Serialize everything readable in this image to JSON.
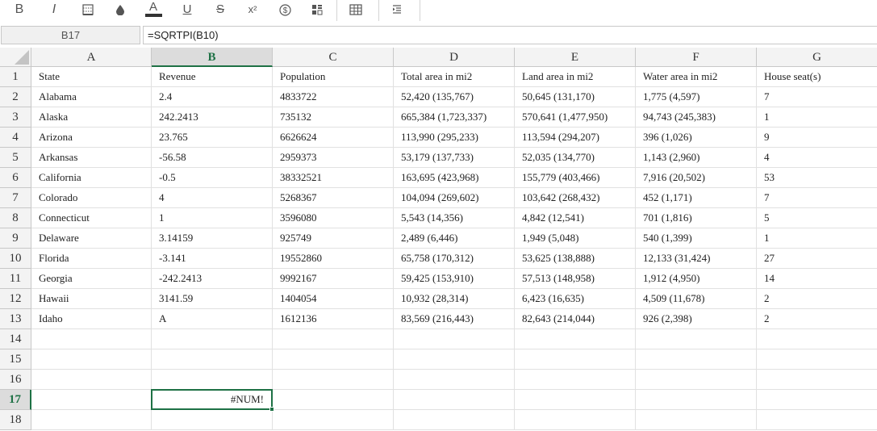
{
  "toolbar": {
    "bold_label": "B",
    "italic_label": "I",
    "font_color_label": "A",
    "underline_label": "U",
    "strike_label": "S",
    "superscript_label": "x²",
    "icons": [
      "borders-icon",
      "fill-color-icon",
      "font-color-icon",
      "underline-icon",
      "strikethrough-icon",
      "superscript-icon",
      "currency-icon",
      "conditional-format-icon",
      "table-icon",
      "indent-icon"
    ],
    "font_color_swatch": "#333333"
  },
  "formula_bar": {
    "cell_ref": "B17",
    "formula": "=SQRTPI(B10)"
  },
  "sheet": {
    "accent": "#1e7145",
    "columns": [
      "A",
      "B",
      "C",
      "D",
      "E",
      "F",
      "G"
    ],
    "active_column": "B",
    "active_row": "17",
    "row_numbers": [
      "1",
      "2",
      "3",
      "4",
      "5",
      "6",
      "7",
      "8",
      "9",
      "10",
      "11",
      "12",
      "13",
      "14",
      "15",
      "16",
      "17",
      "18"
    ],
    "rows": [
      [
        "State",
        "Revenue",
        "Population",
        "Total area in mi2",
        "Land area in mi2",
        "Water area in mi2",
        "House seat(s)"
      ],
      [
        "Alabama",
        "2.4",
        "4833722",
        "52,420 (135,767)",
        "50,645 (131,170)",
        "1,775 (4,597)",
        "7"
      ],
      [
        "Alaska",
        "242.2413",
        "735132",
        "665,384 (1,723,337)",
        "570,641 (1,477,950)",
        "94,743 (245,383)",
        "1"
      ],
      [
        "Arizona",
        "23.765",
        "6626624",
        "113,990 (295,233)",
        "113,594 (294,207)",
        "396 (1,026)",
        "9"
      ],
      [
        "Arkansas",
        "-56.58",
        "2959373",
        "53,179 (137,733)",
        "52,035 (134,770)",
        "1,143 (2,960)",
        "4"
      ],
      [
        "California",
        "-0.5",
        "38332521",
        "163,695 (423,968)",
        "155,779 (403,466)",
        "7,916 (20,502)",
        "53"
      ],
      [
        "Colorado",
        "4",
        "5268367",
        "104,094 (269,602)",
        "103,642 (268,432)",
        "452 (1,171)",
        "7"
      ],
      [
        "Connecticut",
        "1",
        "3596080",
        "5,543 (14,356)",
        "4,842 (12,541)",
        "701 (1,816)",
        "5"
      ],
      [
        "Delaware",
        "3.14159",
        "925749",
        "2,489 (6,446)",
        "1,949 (5,048)",
        "540 (1,399)",
        "1"
      ],
      [
        "Florida",
        "-3.141",
        "19552860",
        "65,758 (170,312)",
        "53,625 (138,888)",
        "12,133 (31,424)",
        "27"
      ],
      [
        "Georgia",
        "-242.2413",
        "9992167",
        "59,425 (153,910)",
        "57,513 (148,958)",
        "1,912 (4,950)",
        "14"
      ],
      [
        "Hawaii",
        "3141.59",
        "1404054",
        "10,932 (28,314)",
        "6,423 (16,635)",
        "4,509 (11,678)",
        "2"
      ],
      [
        "Idaho",
        "A",
        "1612136",
        "83,569 (216,443)",
        "82,643 (214,044)",
        "926 (2,398)",
        "2"
      ],
      [
        "",
        "",
        "",
        "",
        "",
        "",
        ""
      ],
      [
        "",
        "",
        "",
        "",
        "",
        "",
        ""
      ],
      [
        "",
        "",
        "",
        "",
        "",
        "",
        ""
      ],
      [
        "",
        "#NUM!",
        "",
        "",
        "",
        "",
        ""
      ],
      [
        "",
        "",
        "",
        "",
        "",
        "",
        ""
      ]
    ]
  }
}
